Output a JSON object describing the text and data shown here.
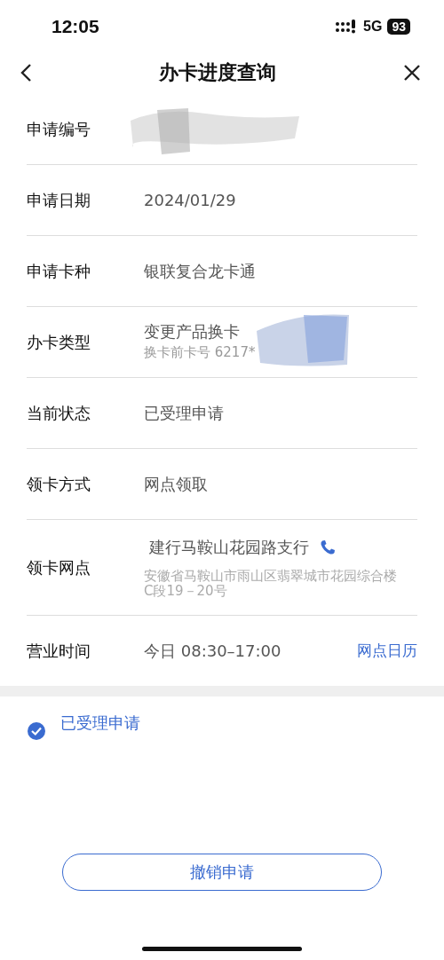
{
  "status_bar": {
    "time": "12:05",
    "network": "5G",
    "battery": "93"
  },
  "nav": {
    "title": "办卡进度查询"
  },
  "rows": [
    {
      "kind": "redacted",
      "label": "申请编号"
    },
    {
      "kind": "plain",
      "label": "申请日期",
      "value": "2024/01/29"
    },
    {
      "kind": "plain",
      "label": "申请卡种",
      "value": "银联复合龙卡通"
    },
    {
      "kind": "detail",
      "label": "办卡类型",
      "value": "变更产品换卡",
      "note": "换卡前卡号 6217*"
    },
    {
      "kind": "plain",
      "label": "当前状态",
      "value": "已受理申请"
    },
    {
      "kind": "plain",
      "label": "领卡方式",
      "value": "网点领取"
    },
    {
      "kind": "branch",
      "label": "领卡网点",
      "value": "建行马鞍山花园路支行",
      "note": "安徽省马鞍山市雨山区翡翠城市花园综合楼C段19－20号"
    },
    {
      "kind": "hours",
      "label": "营业时间",
      "value": "今日 08:30–17:00",
      "link": "网点日历"
    }
  ],
  "steps": [
    {
      "label": "已受理申请",
      "done": true
    }
  ],
  "button": "撤销申请"
}
